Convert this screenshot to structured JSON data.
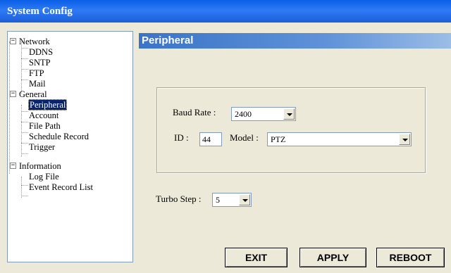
{
  "window": {
    "title": "System Config"
  },
  "tree": {
    "network": "Network",
    "ddns": "DDNS",
    "sntp": "SNTP",
    "ftp": "FTP",
    "mail": "Mail",
    "general": "General",
    "peripheral": "Peripheral",
    "account": "Account",
    "file_path": "File Path",
    "schedule_record": "Schedule Record",
    "trigger": "Trigger",
    "information": "Information",
    "log_file": "Log File",
    "event_record_list": "Event Record List",
    "expander_symbol": "−"
  },
  "panel": {
    "title": "Peripheral",
    "baud_rate_label": "Baud Rate :",
    "baud_rate_value": "2400",
    "id_label": "ID :",
    "id_value": "44",
    "model_label": "Model :",
    "model_value": "PTZ",
    "turbo_step_label": "Turbo Step :",
    "turbo_step_value": "5"
  },
  "buttons": {
    "exit": "EXIT",
    "apply": "APPLY",
    "reboot": "REBOOT"
  },
  "colors": {
    "titlebar": "#0a5fe6",
    "panel_header": "#3a74c8",
    "selection": "#0a246a",
    "window_bg": "#ece9d8"
  },
  "icons": {
    "combo_arrow": "triangle-down"
  }
}
